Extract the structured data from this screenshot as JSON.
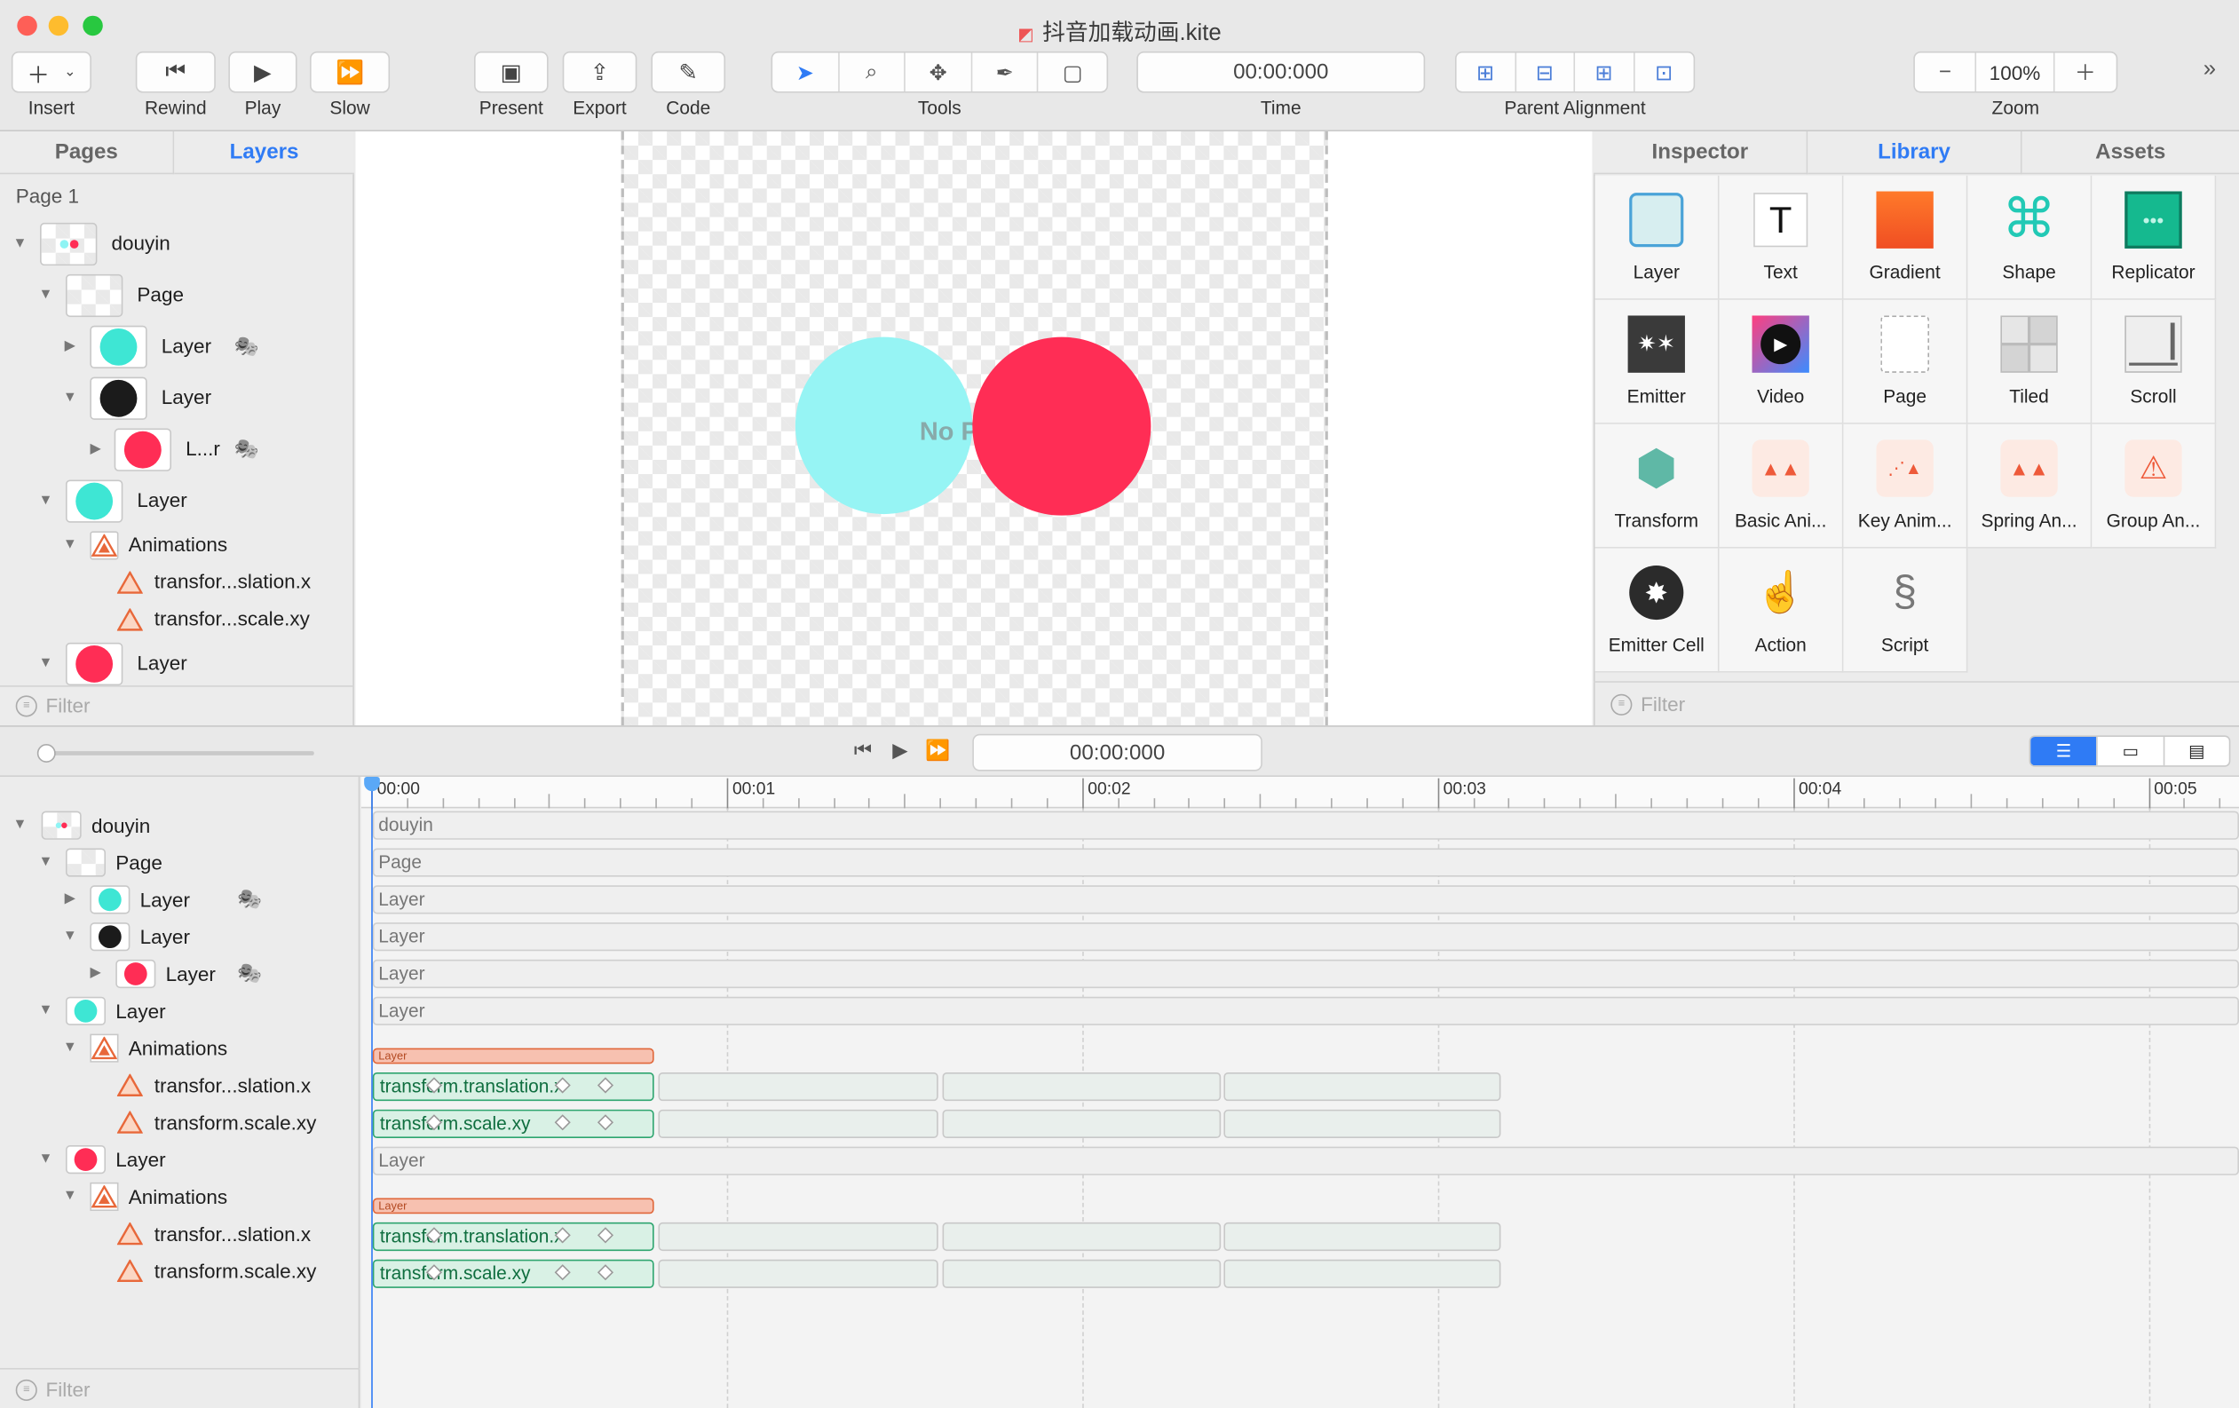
{
  "window": {
    "title": "抖音加载动画.kite"
  },
  "toolbar": {
    "insert": "Insert",
    "rewind": "Rewind",
    "play": "Play",
    "slow": "Slow",
    "present": "Present",
    "export": "Export",
    "code": "Code",
    "tools": "Tools",
    "time_value": "00:00:000",
    "time": "Time",
    "parent_alignment": "Parent Alignment",
    "zoom_value": "100%",
    "zoom": "Zoom"
  },
  "left_panel": {
    "tabs": [
      "Pages",
      "Layers"
    ],
    "page_label": "Page 1",
    "tree": [
      {
        "label": "douyin"
      },
      {
        "label": "Page"
      },
      {
        "label": "Layer"
      },
      {
        "label": "Layer"
      },
      {
        "label": "L...r"
      },
      {
        "label": "Layer"
      },
      {
        "label": "Animations"
      },
      {
        "label": "transfor...slation.x"
      },
      {
        "label": "transfor...scale.xy"
      },
      {
        "label": "Layer"
      }
    ],
    "filter": "Filter"
  },
  "canvas": {
    "overlay_text": "No P"
  },
  "right_panel": {
    "tabs": [
      "Inspector",
      "Library",
      "Assets"
    ],
    "library": [
      "Layer",
      "Text",
      "Gradient",
      "Shape",
      "Replicator",
      "Emitter",
      "Video",
      "Page",
      "Tiled",
      "Scroll",
      "Transform",
      "Basic Ani...",
      "Key Anim...",
      "Spring An...",
      "Group An...",
      "Emitter Cell",
      "Action",
      "Script"
    ],
    "filter": "Filter"
  },
  "timeline": {
    "time_value": "00:00:000",
    "ruler": [
      "00:00",
      "00:01",
      "00:02",
      "00:03",
      "00:04",
      "00:05"
    ],
    "tree": [
      {
        "label": "douyin"
      },
      {
        "label": "Page"
      },
      {
        "label": "Layer"
      },
      {
        "label": "Layer"
      },
      {
        "label": "Layer"
      },
      {
        "label": "Layer"
      },
      {
        "label": "Animations"
      },
      {
        "label": "transfor...slation.x"
      },
      {
        "label": "transform.scale.xy"
      },
      {
        "label": "Layer"
      },
      {
        "label": "Animations"
      },
      {
        "label": "transfor...slation.x"
      },
      {
        "label": "transform.scale.xy"
      }
    ],
    "tracks": [
      "douyin",
      "Page",
      "Layer",
      "Layer",
      "Layer",
      "Layer",
      "Layer"
    ],
    "group_label": "Layer",
    "anim_labels": [
      "transform.translation.x",
      "transform.scale.xy",
      "transform.translation.x",
      "transform.scale.xy"
    ],
    "filter": "Filter"
  },
  "colors": {
    "accent": "#2f7bf5",
    "cyan": "#3ee6d4",
    "red": "#ff2d55",
    "light_cyan": "#8ff4f4",
    "dark": "#1b1b1b"
  }
}
